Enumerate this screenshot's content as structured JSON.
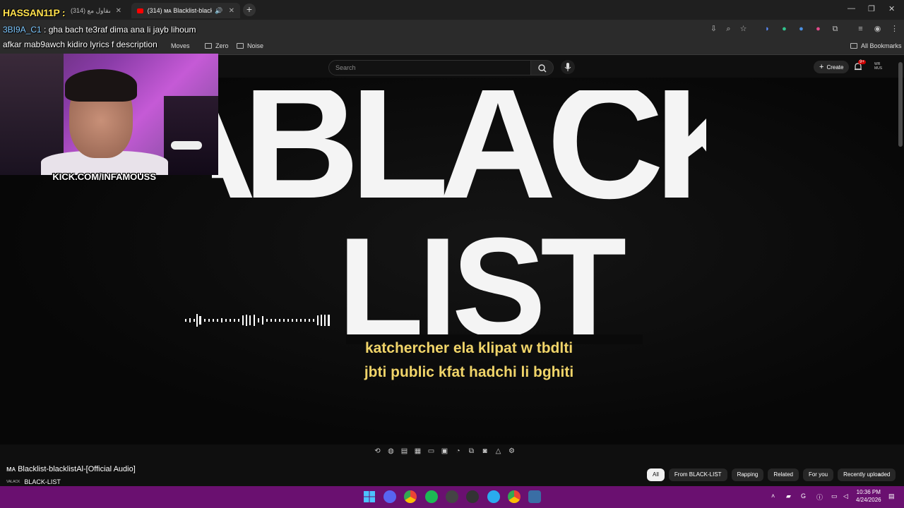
{
  "browser": {
    "tabs": [
      {
        "label": "(314) يوم مع مقاول مع",
        "active": false
      },
      {
        "label": "(314) ᴍᴀ Blacklist-blacklistA",
        "active": true
      }
    ],
    "bookmarks": [
      {
        "label": "Moves"
      },
      {
        "label": "Zero"
      },
      {
        "label": "Noise"
      }
    ],
    "all_bookmarks": "All Bookmarks"
  },
  "overlay": {
    "streamer_name": "HASSAN11P :",
    "chat_user": "3BI9A_C1",
    "chat_message": ": gha bach te3raf dima ana li jayb lihoum",
    "chat_message_2": "afkar mab9awch kidiro lyrics f description",
    "webcam_label_prefix": "K",
    "webcam_label": "KICK.COM/INFAMOUSS"
  },
  "youtube": {
    "search_placeholder": "Search",
    "create_label": "Create",
    "notification_count": "9+",
    "avatar_text": "WR MUS"
  },
  "video": {
    "title_line1": "ᴀBLACK",
    "title_line2": "LIST",
    "lyrics_line1": "katchercher ela klipat w tbdlti",
    "lyrics_line2": "jbti public kfat hadchi li bghiti",
    "video_title": "ᴍᴀ Blacklist-blacklistAl-[Official Audio]",
    "channel_name": "BLACK-LIST",
    "channel_tiny": "VALACK"
  },
  "chips": [
    {
      "label": "All",
      "active": true
    },
    {
      "label": "From BLACK-LIST",
      "active": false
    },
    {
      "label": "Rapping",
      "active": false
    },
    {
      "label": "Related",
      "active": false
    },
    {
      "label": "For you",
      "active": false
    },
    {
      "label": "Recently uploaded",
      "active": false
    }
  ],
  "taskbar": {
    "time": "10:36 PM",
    "date": "4/24/2026"
  },
  "colors": {
    "lyrics": "#f0d469",
    "youtube_red": "#ff0000",
    "kick_green": "#53fc18",
    "taskbar": "#6a1070"
  }
}
